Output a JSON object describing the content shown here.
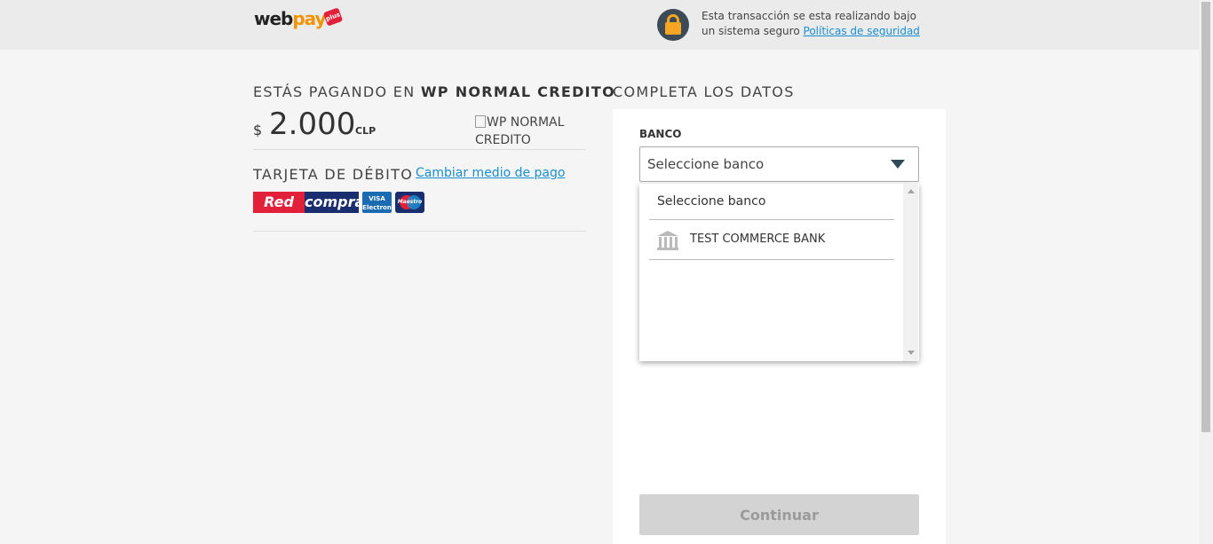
{
  "header": {
    "logo_web": "web",
    "logo_pay": "pay",
    "logo_plus": "plus",
    "secure_text": "Esta transacción se esta realizando bajo un sistema seguro",
    "secure_link": "Políticas de seguridad"
  },
  "summary": {
    "paying_prefix": "ESTÁS PAGANDO EN",
    "merchant": "WP NORMAL CREDITO",
    "currency_symbol": "$",
    "amount": "2.000",
    "currency_code": "CLP",
    "merchant_image_alt": "WP NORMAL CREDITO",
    "card_type": "TARJETA DE DÉBITO",
    "change_payment_link": "Cambiar medio de pago",
    "brand_red": "Red",
    "brand_compra": "compra",
    "brand_visa": "VISA Electron",
    "brand_maestro": "Maestro"
  },
  "form": {
    "title": "COMPLETA LOS DATOS",
    "bank_label": "BANCO",
    "bank_selected": "Seleccione banco",
    "bank_options": [
      "Seleccione banco",
      "TEST COMMERCE BANK"
    ],
    "continue_label": "Continuar"
  },
  "colors": {
    "accent_link": "#1a8ecf",
    "lock_bg": "#3d4b57",
    "lock_fg": "#f6a623",
    "button_disabled": "#d3d3d3"
  }
}
